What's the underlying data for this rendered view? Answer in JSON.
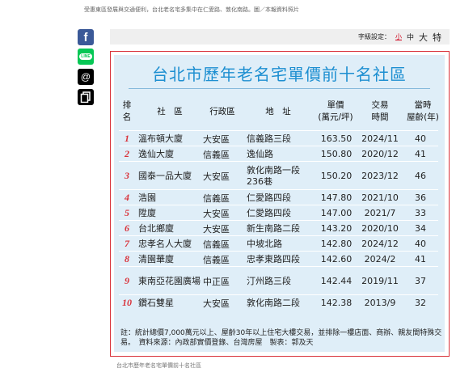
{
  "top_caption": "受惠東區發展與交通便利，台北老名宅多集中在仁愛路、敦化南路。圖／本報資料照片",
  "share": {
    "facebook": "f",
    "line": "LINE",
    "threads": "@",
    "icons": [
      "facebook-icon",
      "line-icon",
      "threads-icon",
      "copy-link-icon"
    ]
  },
  "font_size": {
    "label": "字級設定：",
    "small": "小",
    "medium": "中",
    "large": "大",
    "xlarge": "特"
  },
  "infographic": {
    "title": "台北市歷年老名宅單價前十名社區",
    "headers": {
      "rank": [
        "排",
        "名"
      ],
      "community": "社　區",
      "district": "行政區",
      "address": "地　址",
      "price": [
        "單價",
        "(萬元/坪)"
      ],
      "date": [
        "交易",
        "時間"
      ],
      "age": [
        "當時",
        "屋齡(年)"
      ]
    },
    "rows": [
      {
        "rank": "1",
        "name": "溫布頓大廈",
        "district": "大安區",
        "address": "信義路三段",
        "price": "163.50",
        "date": "2024/11",
        "age": "40"
      },
      {
        "rank": "2",
        "name": "逸仙大廈",
        "district": "信義區",
        "address": "逸仙路",
        "price": "150.80",
        "date": "2020/12",
        "age": "41"
      },
      {
        "rank": "3",
        "name": "國泰一品大廈",
        "district": "大安區",
        "address": "敦化南路一段236巷",
        "price": "150.20",
        "date": "2023/12",
        "age": "46"
      },
      {
        "rank": "4",
        "name": "浩園",
        "district": "信義區",
        "address": "仁愛路四段",
        "price": "147.80",
        "date": "2021/10",
        "age": "36"
      },
      {
        "rank": "5",
        "name": "陞廈",
        "district": "大安區",
        "address": "仁愛路四段",
        "price": "147.00",
        "date": "2021/7",
        "age": "33"
      },
      {
        "rank": "6",
        "name": "台北鄉廈",
        "district": "大安區",
        "address": "新生南路二段",
        "price": "143.20",
        "date": "2020/10",
        "age": "34"
      },
      {
        "rank": "7",
        "name": "忠孝名人大廈",
        "district": "信義區",
        "address": "中坡北路",
        "price": "142.80",
        "date": "2024/12",
        "age": "40"
      },
      {
        "rank": "8",
        "name": "清園華廈",
        "district": "信義區",
        "address": "忠孝東路四段",
        "price": "142.60",
        "date": "2024/2",
        "age": "41"
      },
      {
        "rank": "9",
        "name": "東南亞花園廣場",
        "district": "中正區",
        "address": "汀州路三段",
        "price": "142.44",
        "date": "2019/11",
        "age": "37"
      },
      {
        "rank": "10",
        "name": "鑽石雙星",
        "district": "大安區",
        "address": "敦化南路二段",
        "price": "142.38",
        "date": "2013/9",
        "age": "32"
      }
    ],
    "note": "註：統計總價7,000萬元以上、屋齡30年以上住宅大樓交易，並排除一樓店面、商辦、親友間特殊交易。　資料來源：內政部實價登錄、台灣房屋　製表：郭及天"
  },
  "bottom_caption": "台北市歷年老名宅單價前十名社區"
}
